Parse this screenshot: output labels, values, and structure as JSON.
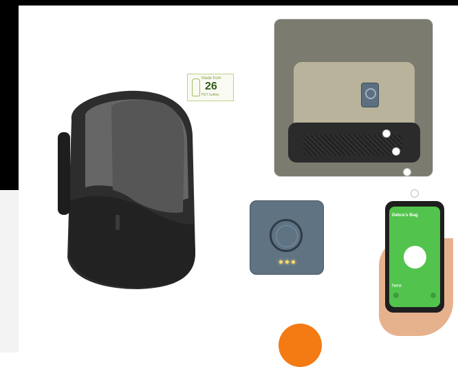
{
  "badge": {
    "line1": "Made from",
    "number": "26",
    "line2": "PET bottles"
  },
  "phone": {
    "title": "Debra's Bag",
    "status": "here"
  },
  "colors": {
    "accent_orange": "#f47a14",
    "phone_green": "#52c34d",
    "tracker_blue": "#5f7383",
    "leaf_green": "#7a9a3a"
  }
}
